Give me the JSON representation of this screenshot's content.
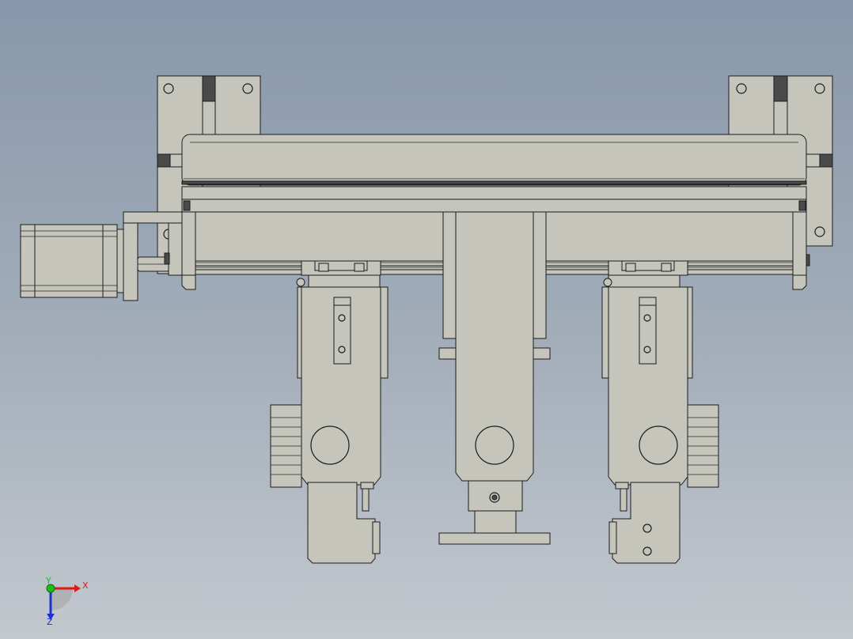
{
  "view": {
    "background_top": "#8797ab",
    "background_bottom": "#c3c8ce",
    "part_color": "#c5c5bc",
    "edge_color": "#1c1c1c"
  },
  "triad": {
    "x_label": "X",
    "y_label": "Y",
    "z_label": "Z",
    "x_color": "#e01818",
    "y_color": "#19c019",
    "z_color": "#2030d0"
  }
}
